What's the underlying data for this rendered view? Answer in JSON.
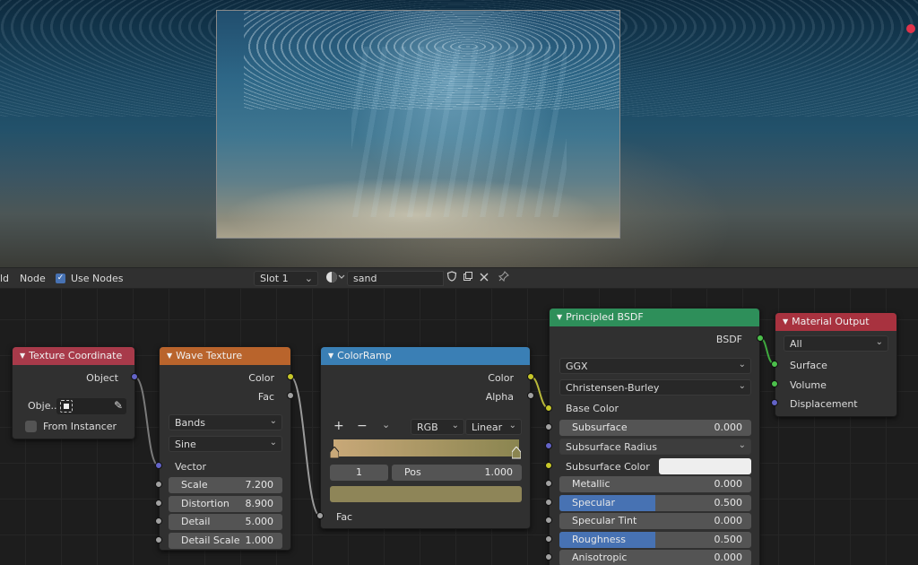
{
  "header": {
    "menu_partial": "ld",
    "node_menu": "Node",
    "use_nodes_label": "Use Nodes",
    "use_nodes_checked": true,
    "slot": "Slot 1",
    "material_name": "sand"
  },
  "nodes": {
    "texture_coordinate": {
      "title": "Texture Coordinate",
      "color": "#a83a4a",
      "output_object": "Object",
      "object_label": "Obje..",
      "from_instancer": "From Instancer"
    },
    "wave_texture": {
      "title": "Wave Texture",
      "color": "#b9642c",
      "out_color": "Color",
      "out_fac": "Fac",
      "type": "Bands",
      "profile": "Sine",
      "in_vector": "Vector",
      "fields": [
        {
          "label": "Scale",
          "value": "7.200"
        },
        {
          "label": "Distortion",
          "value": "8.900"
        },
        {
          "label": "Detail",
          "value": "5.000"
        },
        {
          "label": "Detail Scale",
          "value": "1.000"
        }
      ]
    },
    "color_ramp": {
      "title": "ColorRamp",
      "color": "#3a7fb5",
      "out_color": "Color",
      "out_alpha": "Alpha",
      "add": "+",
      "remove": "−",
      "mode": "RGB",
      "interpolation": "Linear",
      "index": "1",
      "pos_label": "Pos",
      "pos_value": "1.000",
      "gradient_from": "#c8a878",
      "gradient_to": "#8a8550",
      "swatch": "#8e8558",
      "in_fac": "Fac"
    },
    "principled_bsdf": {
      "title": "Principled BSDF",
      "color": "#2e8f5a",
      "out_bsdf": "BSDF",
      "distribution": "GGX",
      "subsurface_method": "Christensen-Burley",
      "base_color": "Base Color",
      "subsurface": {
        "label": "Subsurface",
        "value": "0.000"
      },
      "subsurface_radius": "Subsurface Radius",
      "subsurface_color": "Subsurface Color",
      "subsurface_color_swatch": "#eeeeee",
      "fields": [
        {
          "label": "Metallic",
          "value": "0.000",
          "fill": 0.0
        },
        {
          "label": "Specular",
          "value": "0.500",
          "fill": 0.5
        },
        {
          "label": "Specular Tint",
          "value": "0.000",
          "fill": 0.0
        },
        {
          "label": "Roughness",
          "value": "0.500",
          "fill": 0.5
        },
        {
          "label": "Anisotropic",
          "value": "0.000",
          "fill": 0.0
        }
      ]
    },
    "material_output": {
      "title": "Material Output",
      "color": "#a8323f",
      "target": "All",
      "in_surface": "Surface",
      "in_volume": "Volume",
      "in_displacement": "Displacement"
    }
  }
}
